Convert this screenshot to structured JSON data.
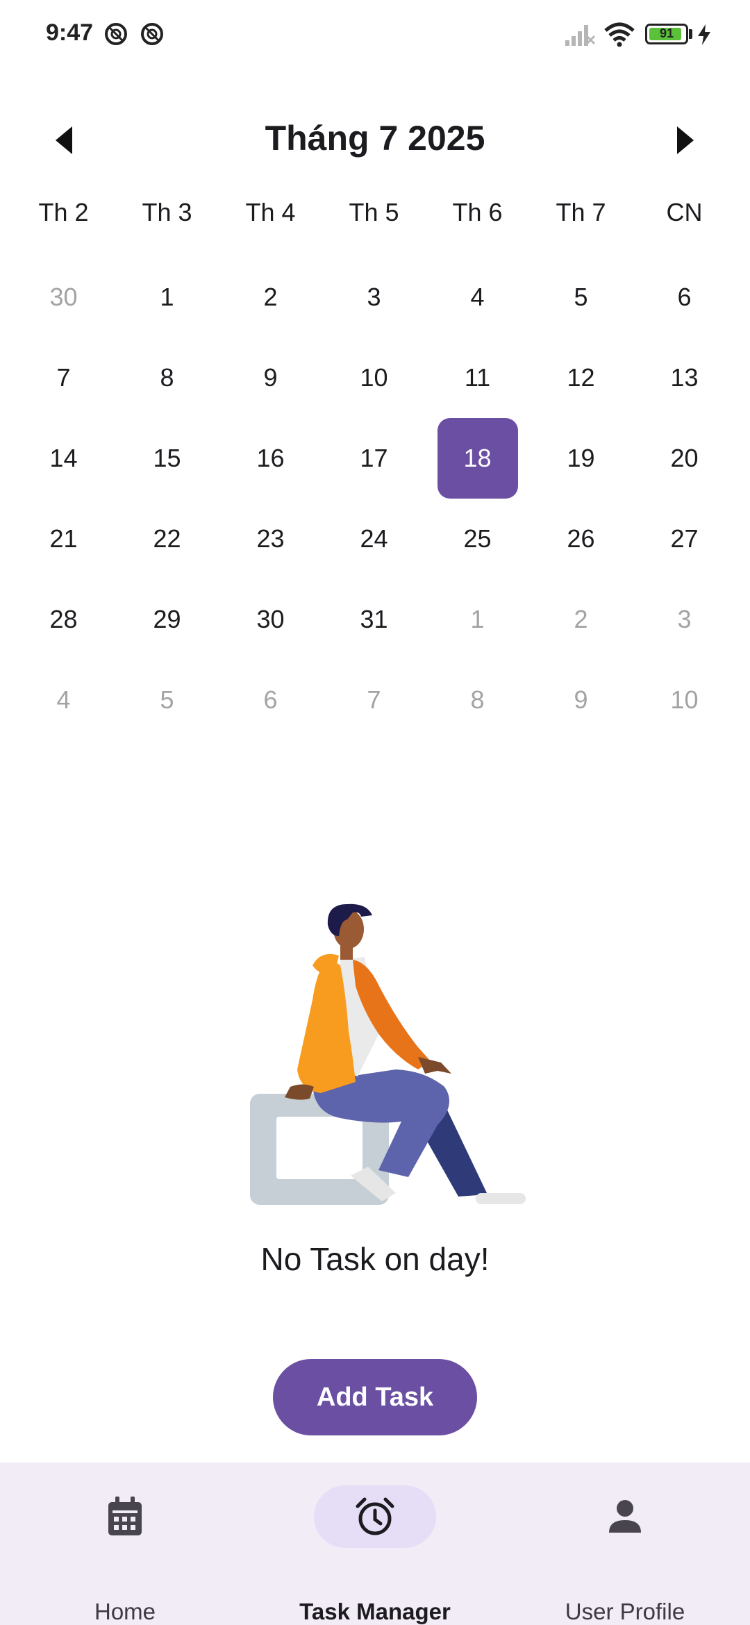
{
  "status_bar": {
    "time": "9:47",
    "battery_level": "91",
    "battery_fraction": 0.91,
    "icons": [
      "dnd-icon",
      "dnd-icon",
      "signal-icon",
      "wifi-icon",
      "battery-icon",
      "charging-icon"
    ]
  },
  "calendar": {
    "month_title": "Tháng 7 2025",
    "prev_icon": "triangle-left-icon",
    "next_icon": "triangle-right-icon",
    "weekdays": [
      "Th 2",
      "Th 3",
      "Th 4",
      "Th 5",
      "Th 6",
      "Th 7",
      "CN"
    ],
    "weeks": [
      [
        "30",
        "1",
        "2",
        "3",
        "4",
        "5",
        "6"
      ],
      [
        "7",
        "8",
        "9",
        "10",
        "11",
        "12",
        "13"
      ],
      [
        "14",
        "15",
        "16",
        "17",
        "18",
        "19",
        "20"
      ],
      [
        "21",
        "22",
        "23",
        "24",
        "25",
        "26",
        "27"
      ],
      [
        "28",
        "29",
        "30",
        "31",
        "1",
        "2",
        "3"
      ],
      [
        "4",
        "5",
        "6",
        "7",
        "8",
        "9",
        "10"
      ]
    ],
    "selected_day": "18",
    "accent_color": "#6a4fa3"
  },
  "empty_state": {
    "message": "No Task on day!"
  },
  "add_task_button": {
    "label": "Add Task"
  },
  "bottom_nav": {
    "items": [
      {
        "label": "Home",
        "icon": "calendar-icon"
      },
      {
        "label": "Task Manager",
        "icon": "alarm-clock-icon"
      },
      {
        "label": "User Profile",
        "icon": "person-icon"
      }
    ],
    "active": "Task Manager"
  }
}
